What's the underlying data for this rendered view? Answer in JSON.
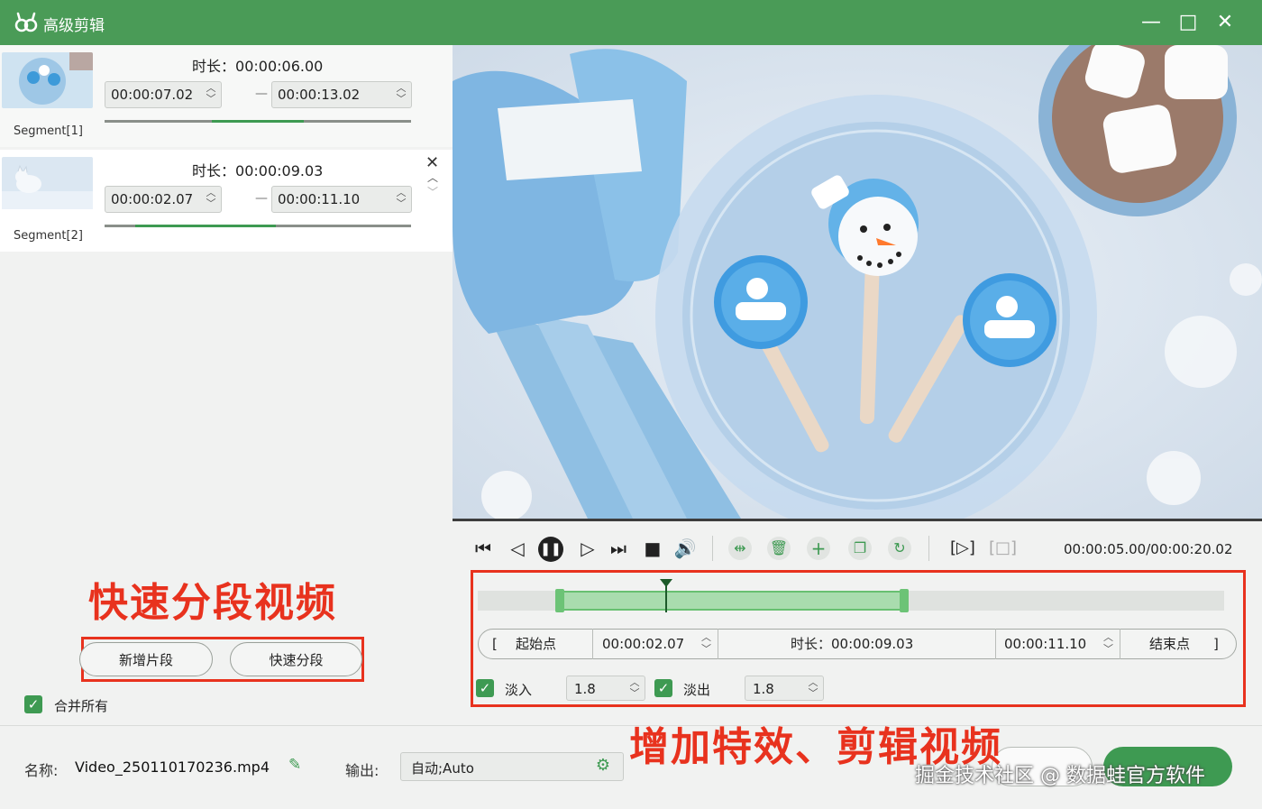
{
  "window": {
    "title": "高级剪辑",
    "controls": [
      "—",
      "□",
      "✕"
    ]
  },
  "segments": [
    {
      "label": "Segment[1]",
      "duration_label": "时长：",
      "duration": "00:00:06.00",
      "start": "00:00:07.02",
      "end": "00:00:13.02",
      "dash": "—",
      "progress_start": 0.35,
      "progress_end": 0.65
    },
    {
      "label": "Segment[2]",
      "duration_label": "时长：",
      "duration": "00:00:09.03",
      "start": "00:00:02.07",
      "end": "00:00:11.10",
      "dash": "—",
      "progress_start": 0.1,
      "progress_end": 0.56
    }
  ],
  "segment_actions": {
    "close": "✕",
    "up": "︿",
    "down": "﹀"
  },
  "left_actions": {
    "annotation": "快速分段视频",
    "add_segment": "新增片段",
    "quick_split": "快速分段",
    "merge_all": "合并所有"
  },
  "player": {
    "timecode": "00:00:05.00/00:00:20.02",
    "timeline_selection_start": 0.107,
    "timeline_selection_end": 0.575,
    "playhead_position": 0.25
  },
  "trim": {
    "start_label": "起始点",
    "start_bracket": "[",
    "start_time": "00:00:02.07",
    "duration_label": "时长：",
    "duration": "00:00:09.03",
    "end_time": "00:00:11.10",
    "end_label": "结束点",
    "end_bracket": "]"
  },
  "fade": {
    "fade_in_label": "淡入",
    "fade_in_value": "1.8",
    "fade_out_label": "淡出",
    "fade_out_value": "1.8"
  },
  "annotations": {
    "effects": "增加特效、剪辑视频"
  },
  "bottom": {
    "name_label": "名称:",
    "file_name": "Video_250110170236.mp4",
    "output_label": "输出:",
    "output_value": "自动;Auto"
  },
  "watermark": "掘金技术社区 @ 数据蛙官方软件",
  "colors": {
    "accent": "#4a9b57",
    "annotation": "#e8321e",
    "selection": "#a9dcae"
  }
}
